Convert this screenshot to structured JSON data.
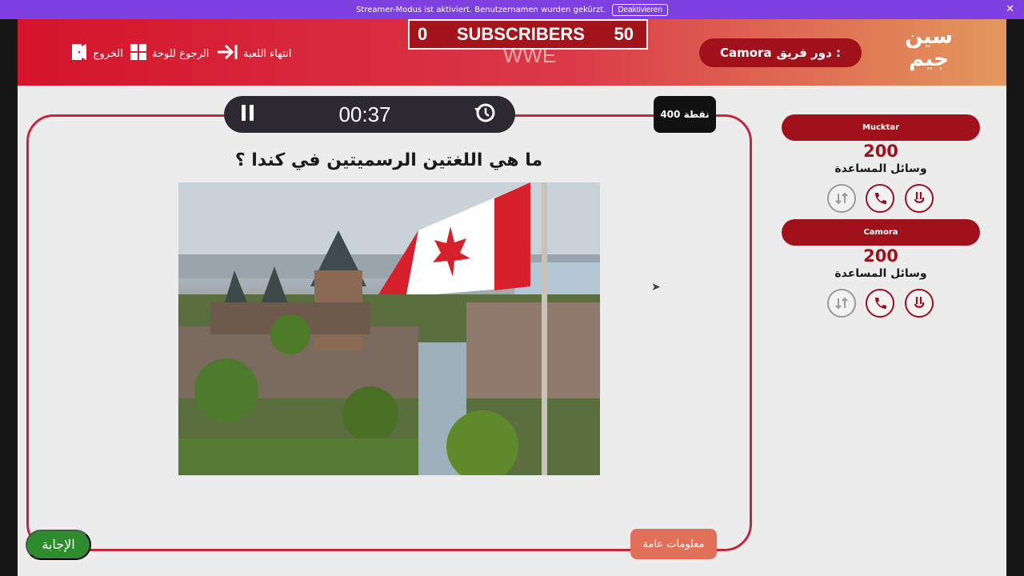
{
  "streamer_bar": {
    "message": "Streamer-Modus ist aktiviert. Benutzernamen wurden gekürzt.",
    "deactivate_label": "Deaktivieren",
    "close": "✕"
  },
  "header": {
    "subscribers_left": "0",
    "subscribers_label": "SUBSCRIBERS",
    "subscribers_right": "50",
    "overlay_text": "WWE",
    "nav": {
      "exit_label": "الخروج",
      "board_label": "الرجوع للوحة",
      "end_game_label": "انتهاء اللعبة"
    },
    "turn_prefix": "دور فريق :",
    "turn_team": "Camora",
    "logo_line1": "سين",
    "logo_line2": "جيم"
  },
  "question_area": {
    "timer": "00:37",
    "points_label": "400 نقطة",
    "question": "ما هي اللغتين الرسميتين في كندا ؟",
    "answer_button": "الإجابة",
    "category": "معلومات عامة"
  },
  "teams": [
    {
      "name": "Mucktar",
      "score": "200",
      "helpers_label": "وسائل المساعدة"
    },
    {
      "name": "Camora",
      "score": "200",
      "helpers_label": "وسائل المساعدة"
    }
  ],
  "colors": {
    "accent_red": "#a0111b",
    "frame_red": "#c1283e",
    "answer_green": "#2e8b2e",
    "category_orange": "#e0705a",
    "streamer_purple": "#7d3fe0"
  }
}
